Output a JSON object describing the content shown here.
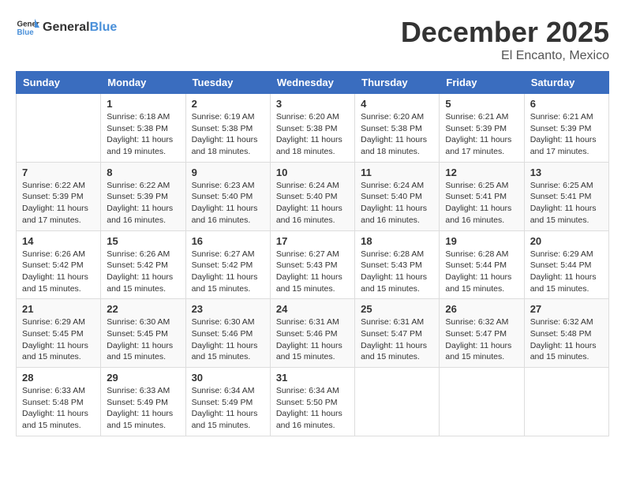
{
  "logo": {
    "general": "General",
    "blue": "Blue"
  },
  "title": {
    "month": "December 2025",
    "location": "El Encanto, Mexico"
  },
  "weekdays": [
    "Sunday",
    "Monday",
    "Tuesday",
    "Wednesday",
    "Thursday",
    "Friday",
    "Saturday"
  ],
  "weeks": [
    [
      {
        "day": "",
        "info": ""
      },
      {
        "day": "1",
        "info": "Sunrise: 6:18 AM\nSunset: 5:38 PM\nDaylight: 11 hours\nand 19 minutes."
      },
      {
        "day": "2",
        "info": "Sunrise: 6:19 AM\nSunset: 5:38 PM\nDaylight: 11 hours\nand 18 minutes."
      },
      {
        "day": "3",
        "info": "Sunrise: 6:20 AM\nSunset: 5:38 PM\nDaylight: 11 hours\nand 18 minutes."
      },
      {
        "day": "4",
        "info": "Sunrise: 6:20 AM\nSunset: 5:38 PM\nDaylight: 11 hours\nand 18 minutes."
      },
      {
        "day": "5",
        "info": "Sunrise: 6:21 AM\nSunset: 5:39 PM\nDaylight: 11 hours\nand 17 minutes."
      },
      {
        "day": "6",
        "info": "Sunrise: 6:21 AM\nSunset: 5:39 PM\nDaylight: 11 hours\nand 17 minutes."
      }
    ],
    [
      {
        "day": "7",
        "info": "Sunrise: 6:22 AM\nSunset: 5:39 PM\nDaylight: 11 hours\nand 17 minutes."
      },
      {
        "day": "8",
        "info": "Sunrise: 6:22 AM\nSunset: 5:39 PM\nDaylight: 11 hours\nand 16 minutes."
      },
      {
        "day": "9",
        "info": "Sunrise: 6:23 AM\nSunset: 5:40 PM\nDaylight: 11 hours\nand 16 minutes."
      },
      {
        "day": "10",
        "info": "Sunrise: 6:24 AM\nSunset: 5:40 PM\nDaylight: 11 hours\nand 16 minutes."
      },
      {
        "day": "11",
        "info": "Sunrise: 6:24 AM\nSunset: 5:40 PM\nDaylight: 11 hours\nand 16 minutes."
      },
      {
        "day": "12",
        "info": "Sunrise: 6:25 AM\nSunset: 5:41 PM\nDaylight: 11 hours\nand 16 minutes."
      },
      {
        "day": "13",
        "info": "Sunrise: 6:25 AM\nSunset: 5:41 PM\nDaylight: 11 hours\nand 15 minutes."
      }
    ],
    [
      {
        "day": "14",
        "info": "Sunrise: 6:26 AM\nSunset: 5:42 PM\nDaylight: 11 hours\nand 15 minutes."
      },
      {
        "day": "15",
        "info": "Sunrise: 6:26 AM\nSunset: 5:42 PM\nDaylight: 11 hours\nand 15 minutes."
      },
      {
        "day": "16",
        "info": "Sunrise: 6:27 AM\nSunset: 5:42 PM\nDaylight: 11 hours\nand 15 minutes."
      },
      {
        "day": "17",
        "info": "Sunrise: 6:27 AM\nSunset: 5:43 PM\nDaylight: 11 hours\nand 15 minutes."
      },
      {
        "day": "18",
        "info": "Sunrise: 6:28 AM\nSunset: 5:43 PM\nDaylight: 11 hours\nand 15 minutes."
      },
      {
        "day": "19",
        "info": "Sunrise: 6:28 AM\nSunset: 5:44 PM\nDaylight: 11 hours\nand 15 minutes."
      },
      {
        "day": "20",
        "info": "Sunrise: 6:29 AM\nSunset: 5:44 PM\nDaylight: 11 hours\nand 15 minutes."
      }
    ],
    [
      {
        "day": "21",
        "info": "Sunrise: 6:29 AM\nSunset: 5:45 PM\nDaylight: 11 hours\nand 15 minutes."
      },
      {
        "day": "22",
        "info": "Sunrise: 6:30 AM\nSunset: 5:45 PM\nDaylight: 11 hours\nand 15 minutes."
      },
      {
        "day": "23",
        "info": "Sunrise: 6:30 AM\nSunset: 5:46 PM\nDaylight: 11 hours\nand 15 minutes."
      },
      {
        "day": "24",
        "info": "Sunrise: 6:31 AM\nSunset: 5:46 PM\nDaylight: 11 hours\nand 15 minutes."
      },
      {
        "day": "25",
        "info": "Sunrise: 6:31 AM\nSunset: 5:47 PM\nDaylight: 11 hours\nand 15 minutes."
      },
      {
        "day": "26",
        "info": "Sunrise: 6:32 AM\nSunset: 5:47 PM\nDaylight: 11 hours\nand 15 minutes."
      },
      {
        "day": "27",
        "info": "Sunrise: 6:32 AM\nSunset: 5:48 PM\nDaylight: 11 hours\nand 15 minutes."
      }
    ],
    [
      {
        "day": "28",
        "info": "Sunrise: 6:33 AM\nSunset: 5:48 PM\nDaylight: 11 hours\nand 15 minutes."
      },
      {
        "day": "29",
        "info": "Sunrise: 6:33 AM\nSunset: 5:49 PM\nDaylight: 11 hours\nand 15 minutes."
      },
      {
        "day": "30",
        "info": "Sunrise: 6:34 AM\nSunset: 5:49 PM\nDaylight: 11 hours\nand 15 minutes."
      },
      {
        "day": "31",
        "info": "Sunrise: 6:34 AM\nSunset: 5:50 PM\nDaylight: 11 hours\nand 16 minutes."
      },
      {
        "day": "",
        "info": ""
      },
      {
        "day": "",
        "info": ""
      },
      {
        "day": "",
        "info": ""
      }
    ]
  ]
}
